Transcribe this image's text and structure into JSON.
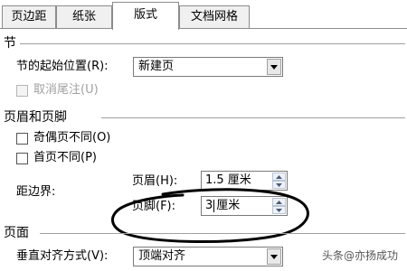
{
  "tabs": [
    {
      "label": "页边距"
    },
    {
      "label": "纸张"
    },
    {
      "label": "版式"
    },
    {
      "label": "文档网格"
    }
  ],
  "section_start": {
    "title": "节",
    "start_label": "节的起始位置(R):",
    "start_value": "新建页",
    "suppress_endnotes_label": "取消尾注(U)"
  },
  "headers_footers": {
    "title": "页眉和页脚",
    "odd_even_label": "奇偶页不同(O)",
    "first_page_label": "首页不同(P)",
    "from_edge_label": "距边界:",
    "header_label": "页眉(H):",
    "header_value": "1.5 厘米",
    "footer_label": "页脚(F):",
    "footer_value_pre": "3",
    "footer_value_post": "厘米"
  },
  "page": {
    "title": "页面",
    "valign_label": "垂直对齐方式(V):",
    "valign_value": "顶端对齐"
  },
  "watermark": "头条@亦扬成功",
  "colors": {
    "annotation": "#000000"
  }
}
